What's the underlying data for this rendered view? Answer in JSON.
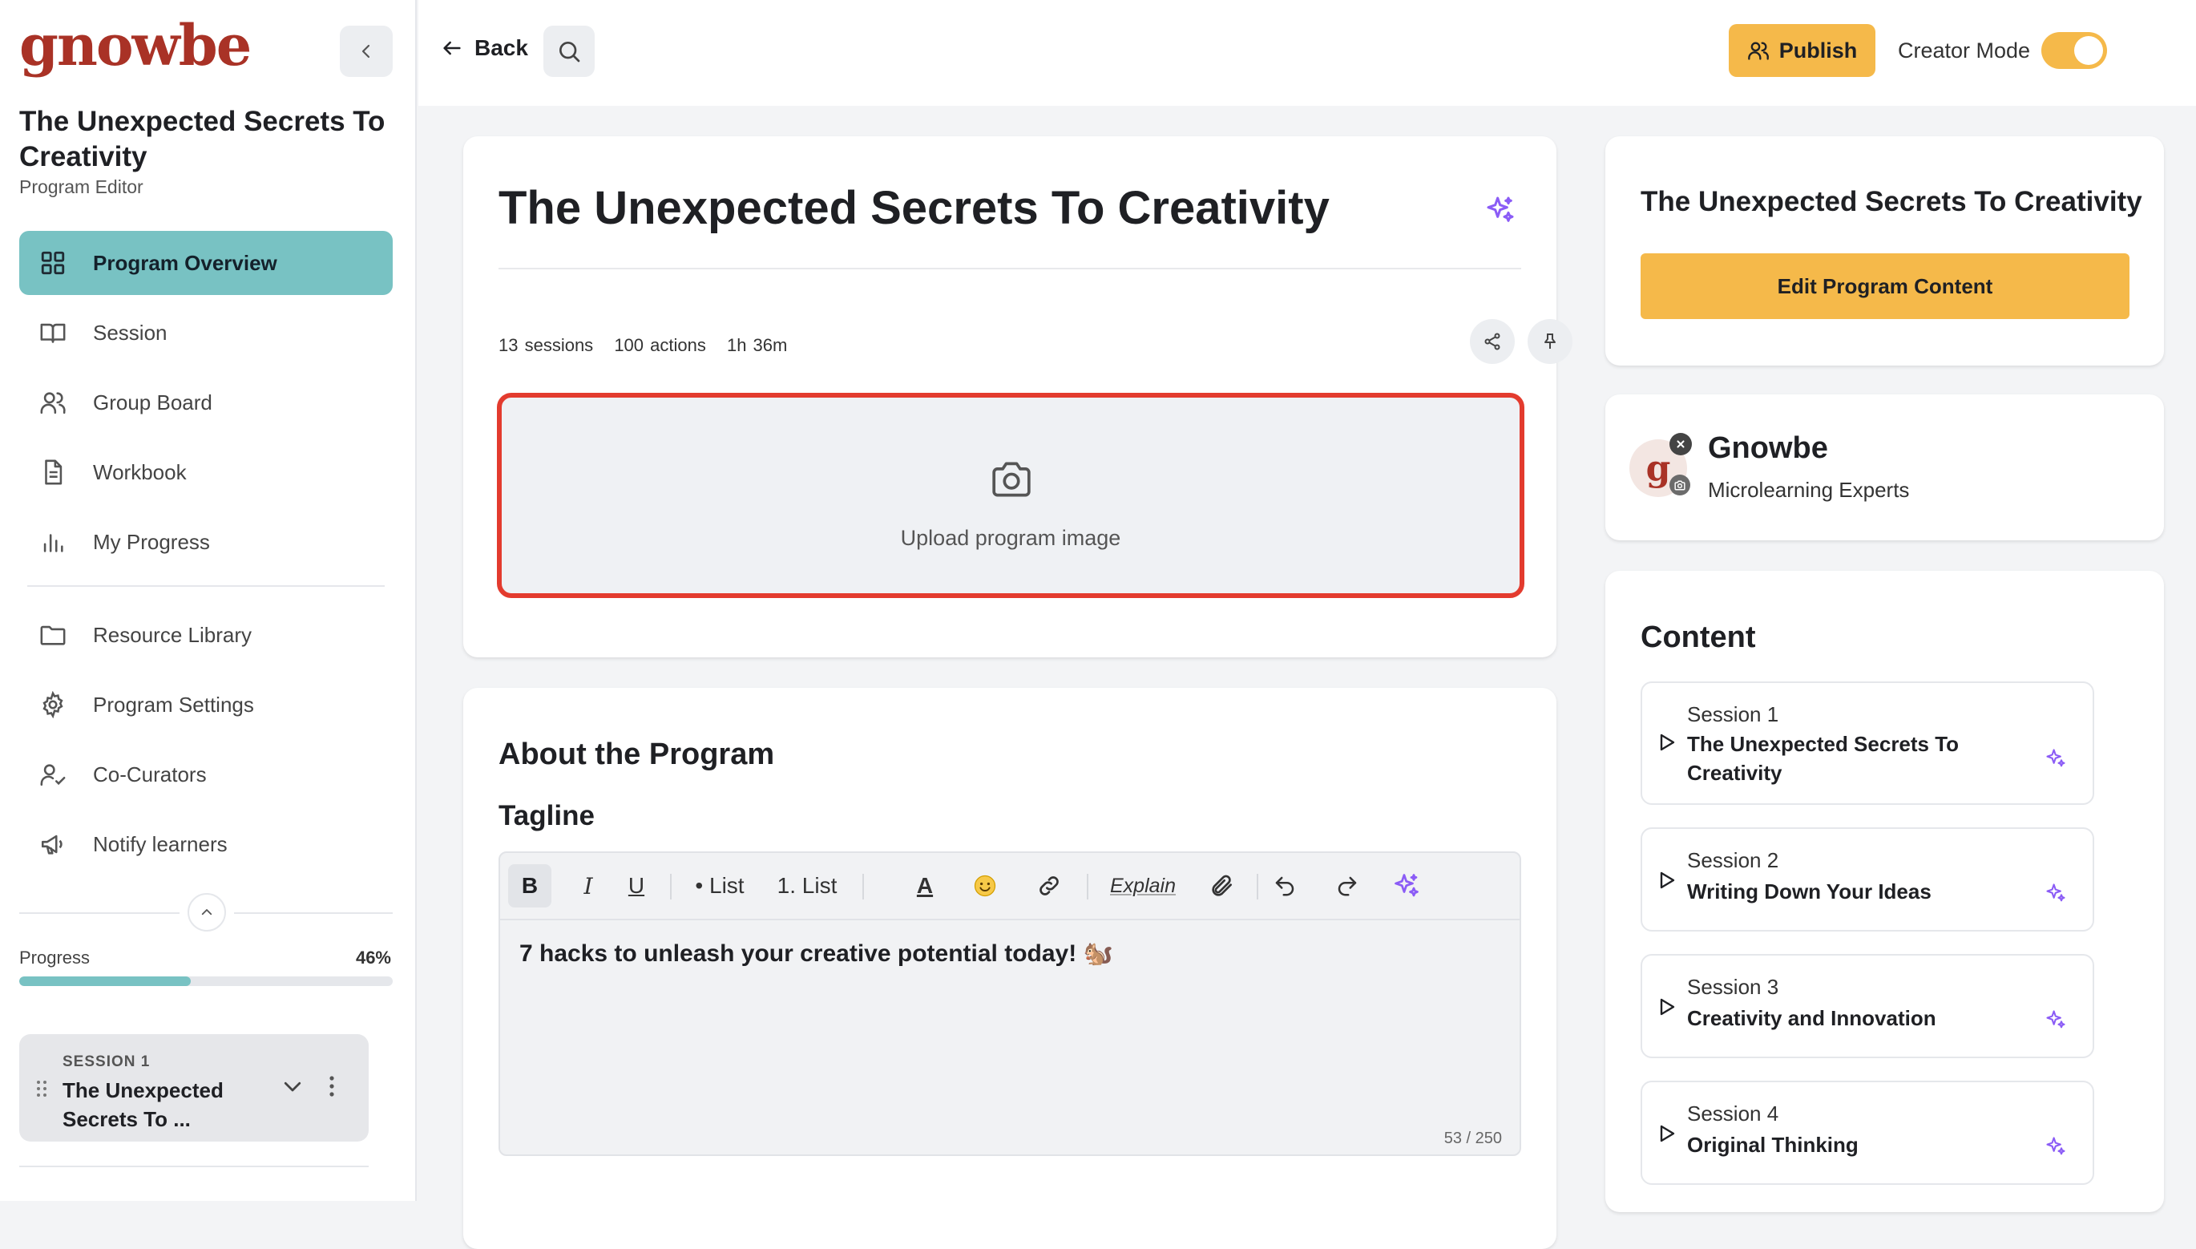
{
  "sidebar": {
    "logo": "gnowbe",
    "program_title": "The Unexpected Secrets To Creativity",
    "program_subtitle": "Program Editor",
    "nav_primary": [
      {
        "label": "Program Overview",
        "icon": "grid-icon",
        "active": true
      },
      {
        "label": "Session",
        "icon": "book-icon"
      },
      {
        "label": "Group Board",
        "icon": "users-icon"
      },
      {
        "label": "Workbook",
        "icon": "document-icon"
      },
      {
        "label": "My Progress",
        "icon": "bar-chart-icon"
      }
    ],
    "nav_secondary": [
      {
        "label": "Resource Library",
        "icon": "folder-icon"
      },
      {
        "label": "Program Settings",
        "icon": "gear-icon"
      },
      {
        "label": "Co-Curators",
        "icon": "user-check-icon"
      },
      {
        "label": "Notify learners",
        "icon": "megaphone-icon"
      }
    ],
    "progress_label": "Progress",
    "progress_value": "46%",
    "progress_fraction": 0.46,
    "session_card": {
      "kicker": "SESSION 1",
      "title": "The Unexpected Secrets To ..."
    }
  },
  "topbar": {
    "back_label": "Back",
    "publish_label": "Publish",
    "creator_mode_label": "Creator Mode",
    "creator_mode_on": true
  },
  "main": {
    "title": "The Unexpected Secrets To Creativity",
    "meta": {
      "sessions": "13 sessions",
      "actions": "100 actions",
      "duration": "1h 36m"
    },
    "upload_label": "Upload program image"
  },
  "about": {
    "heading": "About the Program",
    "tagline_heading": "Tagline",
    "toolbar": {
      "bold": "B",
      "italic": "I",
      "underline": "U",
      "bullet_list": "• List",
      "numbered_list": "1. List",
      "text_color": "A",
      "explain": "Explain"
    },
    "tagline_text": "7 hacks to unleash your creative potential today! 🐿️",
    "char_counter": "53 / 250"
  },
  "right": {
    "program_title": "The Unexpected Secrets To Creativity",
    "edit_button": "Edit Program Content",
    "org_name": "Gnowbe",
    "org_tagline": "Microlearning Experts",
    "org_avatar_letter": "g",
    "content_heading": "Content",
    "sessions": [
      {
        "number": "Session 1",
        "title": "The Unexpected Secrets To Creativity"
      },
      {
        "number": "Session 2",
        "title": "Writing Down Your Ideas"
      },
      {
        "number": "Session 3",
        "title": "Creativity and Innovation"
      },
      {
        "number": "Session 4",
        "title": "Original Thinking"
      }
    ]
  },
  "colors": {
    "accent": "#f5b94a",
    "teal": "#78c2c3",
    "brand_red": "#a93226",
    "highlight_red": "#e33b2e",
    "ai_purple": "#8b5cf6"
  }
}
